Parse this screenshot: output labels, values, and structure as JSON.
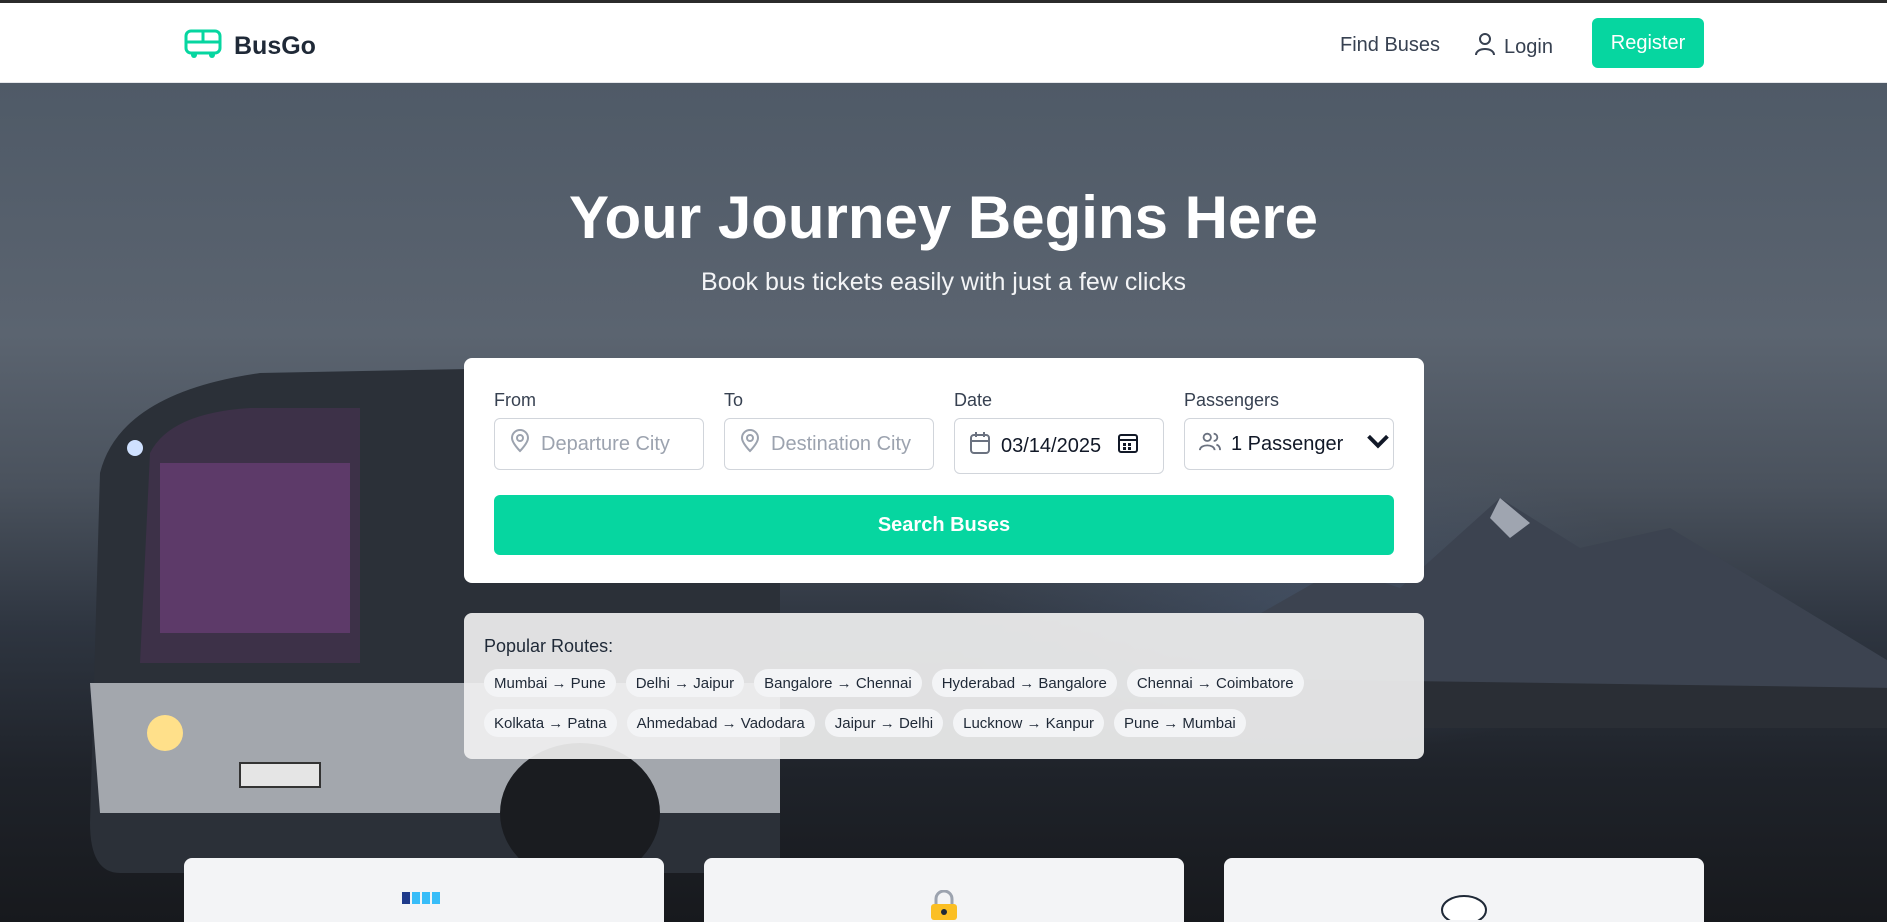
{
  "brand": {
    "name": "BusGo",
    "accent": "#06d6a0"
  },
  "nav": {
    "find_buses": "Find Buses",
    "login": "Login",
    "register": "Register"
  },
  "hero": {
    "title": "Your Journey Begins Here",
    "subtitle": "Book bus tickets easily with just a few clicks"
  },
  "search": {
    "from_label": "From",
    "from_placeholder": "Departure City",
    "to_label": "To",
    "to_placeholder": "Destination City",
    "date_label": "Date",
    "date_value": "03/14/2025",
    "passengers_label": "Passengers",
    "passengers_value": "1 Passenger",
    "button": "Search Buses"
  },
  "popular": {
    "title": "Popular Routes:",
    "routes": [
      "Mumbai → Pune",
      "Delhi → Jaipur",
      "Bangalore → Chennai",
      "Hyderabad → Bangalore",
      "Chennai → Coimbatore",
      "Kolkata → Patna",
      "Ahmedabad → Vadodara",
      "Jaipur → Delhi",
      "Lucknow → Kanpur",
      "Pune → Mumbai"
    ]
  },
  "features": [
    "bus-seats-icon",
    "lock-icon",
    "chat-bubble-icon"
  ]
}
